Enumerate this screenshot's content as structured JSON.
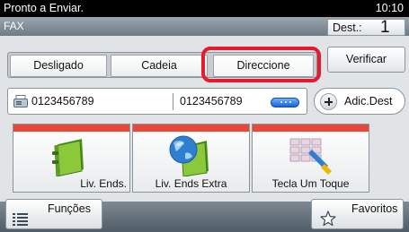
{
  "status_bar": {
    "message": "Pronto a Enviar.",
    "time": "10:10"
  },
  "header": {
    "title": "FAX",
    "dest_label": "Dest.:",
    "dest_count": "1"
  },
  "mode_tabs": [
    {
      "label": "Desligado"
    },
    {
      "label": "Cadeia"
    },
    {
      "label": "Direccione",
      "highlighted": true
    }
  ],
  "verify_button": "Verificar",
  "destinations": {
    "numbers": [
      "0123456789",
      "0123456789"
    ],
    "more_icon": "more-dots-icon"
  },
  "add_dest_button": "Adic.Dest",
  "tiles": [
    {
      "label": "Liv. Ends.",
      "icon": "address-book-icon"
    },
    {
      "label": "Liv. Ends Extra",
      "icon": "external-address-book-icon"
    },
    {
      "label": "Tecla Um Toque",
      "icon": "one-touch-key-icon"
    }
  ],
  "bottom_bar": {
    "functions_label": "Funções",
    "favorites_label": "Favoritos"
  },
  "colors": {
    "highlight": "#e8192c",
    "tile_top": "#e8473a",
    "status_bar": "#000000"
  }
}
